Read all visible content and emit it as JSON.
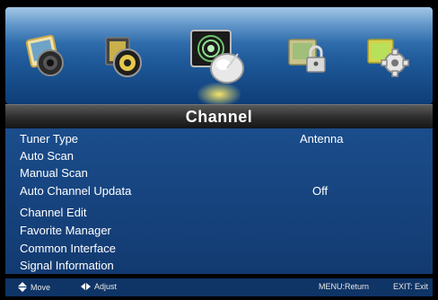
{
  "menu_icons": [
    {
      "name": "picture-icon",
      "selected": false
    },
    {
      "name": "sound-icon",
      "selected": false
    },
    {
      "name": "channel-satellite-icon",
      "selected": true
    },
    {
      "name": "lock-icon",
      "selected": false
    },
    {
      "name": "setup-gear-icon",
      "selected": false
    }
  ],
  "title": "Channel",
  "items": [
    {
      "label": "Tuner Type",
      "value": "Antenna"
    },
    {
      "label": "Auto Scan",
      "value": ""
    },
    {
      "label": "Manual Scan",
      "value": ""
    },
    {
      "label": "Auto Channel Updata",
      "value": "Off"
    },
    {
      "label": "Channel Edit",
      "value": ""
    },
    {
      "label": "Favorite Manager",
      "value": ""
    },
    {
      "label": "Common Interface",
      "value": ""
    },
    {
      "label": "Signal Information",
      "value": ""
    }
  ],
  "footer": {
    "move": "Move",
    "adjust": "Adjust",
    "menu": "MENU:Return",
    "exit": "EXIT: Exit"
  },
  "colors": {
    "list_bg": "#1b4d8c",
    "strip_bg": "#1f5a9a",
    "selected_glow": "#f6e56a"
  }
}
